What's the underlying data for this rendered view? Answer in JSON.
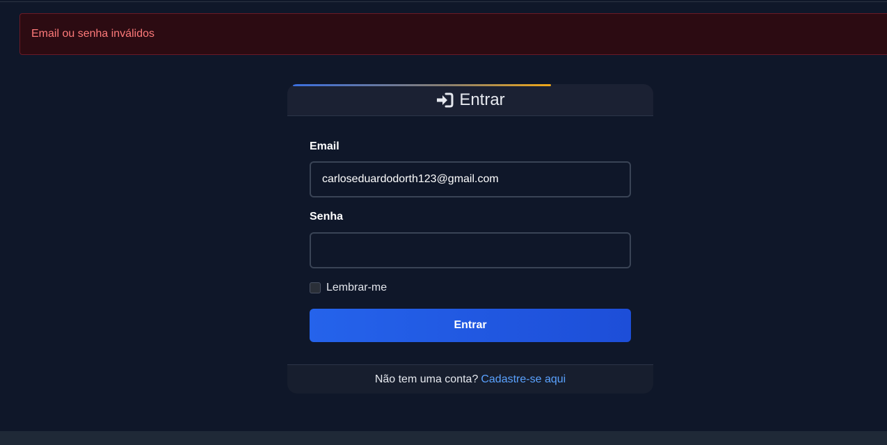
{
  "alert": {
    "message": "Email ou senha inválidos"
  },
  "login": {
    "title": "Entrar",
    "icon": "sign-in-icon",
    "email_label": "Email",
    "email_value": "carloseduardodorth123@gmail.com",
    "password_label": "Senha",
    "password_value": "",
    "remember_label": "Lembrar-me",
    "remember_checked": false,
    "submit_label": "Entrar",
    "footer_text": "Não tem uma conta?",
    "signup_link": "Cadastre-se aqui"
  },
  "colors": {
    "background": "#0f1729",
    "alert_text": "#ff7a7a",
    "primary_button": "#2563eb",
    "link": "#5aa2ff"
  }
}
